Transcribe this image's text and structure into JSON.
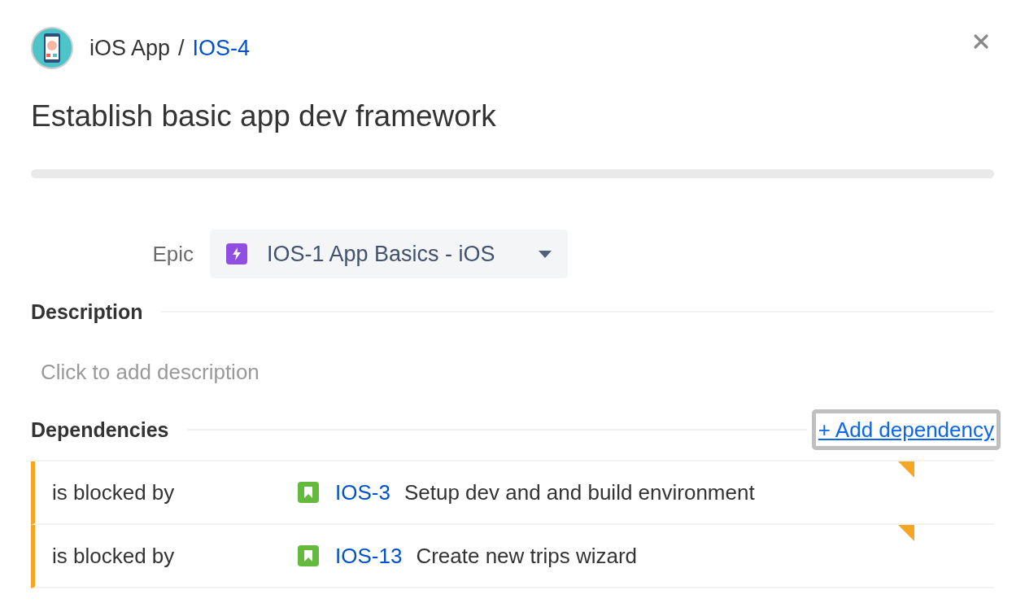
{
  "header": {
    "project": "iOS App",
    "separator": "/",
    "issue_key": "IOS-4"
  },
  "title": "Establish basic app dev framework",
  "epic": {
    "label": "Epic",
    "value": "IOS-1 App Basics - iOS"
  },
  "description": {
    "heading": "Description",
    "placeholder": "Click to add description"
  },
  "dependencies": {
    "heading": "Dependencies",
    "add_link": "+ Add dependency",
    "rows": [
      {
        "relation": "is blocked by",
        "key": "IOS-3",
        "summary": "Setup dev and and build environment",
        "flagged": true
      },
      {
        "relation": "is blocked by",
        "key": "IOS-13",
        "summary": "Create new trips wizard",
        "flagged": true
      }
    ]
  }
}
